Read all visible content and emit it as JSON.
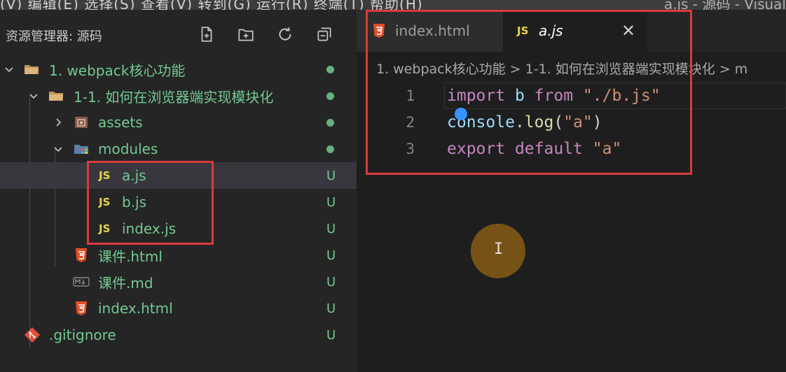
{
  "window": {
    "menu_text": "(V)   编辑(E)   选择(S)   查看(V)   转到(G)   运行(R)   终端(T)   帮助(H)",
    "title_text": "a.js - 源码 - Visual"
  },
  "sidebar": {
    "title": "资源管理器: 源码",
    "actions": [
      "new-file",
      "new-folder",
      "refresh",
      "collapse-all"
    ]
  },
  "tree": [
    {
      "label": "1. webpack核心功能",
      "status": "dot"
    },
    {
      "label": "1-1. 如何在浏览器端实现模块化",
      "status": "dot"
    },
    {
      "label": "assets",
      "status": "dot"
    },
    {
      "label": "modules",
      "status": "dot"
    },
    {
      "label": "a.js",
      "status": "U",
      "badge": "JS"
    },
    {
      "label": "b.js",
      "status": "U",
      "badge": "JS"
    },
    {
      "label": "index.js",
      "status": "U",
      "badge": "JS"
    },
    {
      "label": "课件.html",
      "status": "U"
    },
    {
      "label": "课件.md",
      "status": "U"
    },
    {
      "label": "index.html",
      "status": "U"
    },
    {
      "label": ".gitignore",
      "status": "U"
    }
  ],
  "editor": {
    "tabs": [
      {
        "label": "index.html",
        "active": false
      },
      {
        "label": "a.js",
        "active": true,
        "badge": "JS"
      }
    ],
    "close_glyph": "✕",
    "breadcrumb": "1. webpack核心功能 > 1-1. 如何在浏览器端实现模块化 > m",
    "lines": [
      {
        "number": "1",
        "text": "import b from \"./b.js\""
      },
      {
        "number": "2",
        "text": "console.log(\"a\")"
      },
      {
        "number": "3",
        "text": "export default \"a\""
      }
    ]
  },
  "colors": {
    "untracked_green": "#73c991",
    "js_yellow": "#e8d44d",
    "html_orange": "#e44d26",
    "annotation_red": "#d93b3b"
  }
}
